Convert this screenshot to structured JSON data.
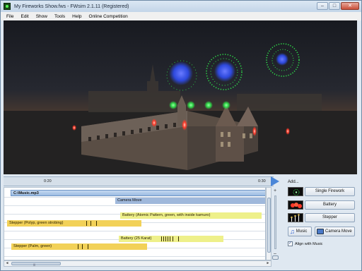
{
  "window": {
    "title": "My Fireworks Show.fws - FWsim 2.1.11  (Registered)",
    "minimize": "–",
    "maximize": "□",
    "close": "✕"
  },
  "menu": [
    "File",
    "Edit",
    "Show",
    "Tools",
    "Help",
    "Online Competition"
  ],
  "timeline": {
    "tick_labels": [
      "0:20",
      "0:30"
    ],
    "tracks": {
      "music": "C:\\Music.mp3",
      "camera": "Camera Move",
      "battery1": "Battery (Atomic Pattern, green, with inside kamuro)",
      "stepper1": "Stepper (Polyp, green strobing)",
      "battery2": "Battery (25 Karat)",
      "stepper2": "Stepper (Palm, green)"
    },
    "zoom_plus": "+",
    "zoom_minus": "–",
    "scroll_left": "◄",
    "scroll_right": "►"
  },
  "panel": {
    "add_label": "Add...",
    "buttons": {
      "single": "Single Firework",
      "battery": "Battery",
      "stepper": "Stepper",
      "music": "Music",
      "camera": "Camera Move"
    },
    "align_checked": true,
    "align_label": "Align with Music",
    "check_mark": "✓"
  },
  "colors": {
    "firework_green": "#2ee84a",
    "firework_blue": "#2f4df0",
    "firework_red": "#ff3a2a",
    "track_yellow": "#f2d158",
    "music_blue": "#9cbce2"
  }
}
